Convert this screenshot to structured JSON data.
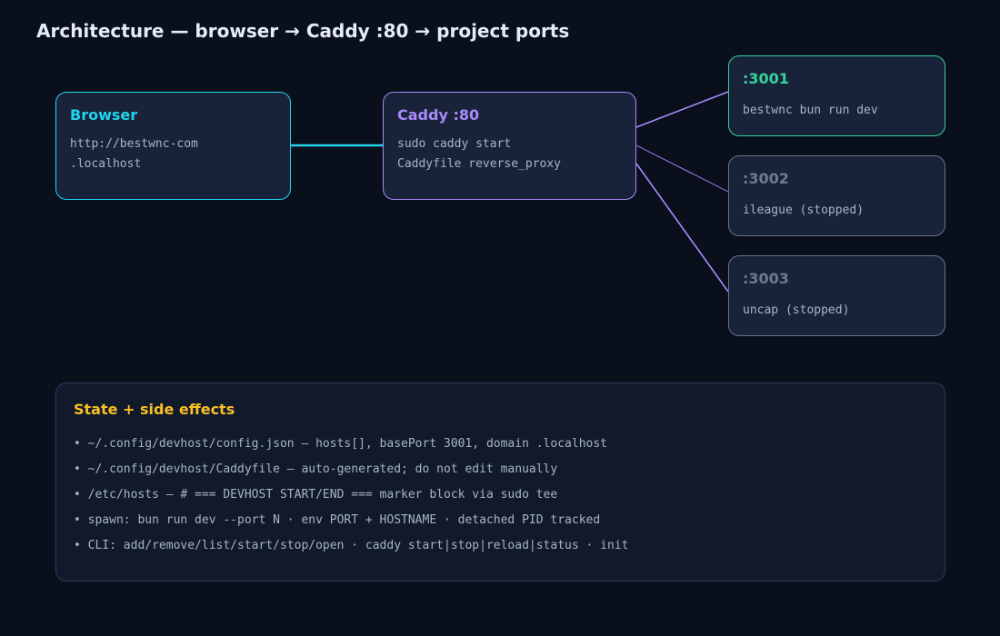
{
  "title": "Architecture — browser → Caddy :80 → project ports",
  "colors": {
    "background": "#0a0f1c",
    "browser_accent": "#22d3ee",
    "caddy_accent": "#a78bfa",
    "active_port": "#34d399",
    "stopped_port": "#64748b",
    "state_accent": "#fbbf24"
  },
  "nodes": {
    "browser": {
      "title": "Browser",
      "lines": [
        "http://bestwnc-com",
        ".localhost"
      ]
    },
    "caddy": {
      "title": "Caddy :80",
      "lines": [
        "sudo caddy start",
        "Caddyfile reverse_proxy"
      ]
    },
    "ports": [
      {
        "title": ":3001",
        "line": "bestwnc bun run dev",
        "status": "running"
      },
      {
        "title": ":3002",
        "line": "ileague (stopped)",
        "status": "stopped"
      },
      {
        "title": ":3003",
        "line": "uncap (stopped)",
        "status": "stopped"
      }
    ]
  },
  "state": {
    "title": "State + side effects",
    "items": [
      "• ~/.config/devhost/config.json — hosts[], basePort 3001, domain .localhost",
      "• ~/.config/devhost/Caddyfile — auto-generated; do not edit manually",
      "• /etc/hosts — # === DEVHOST START/END === marker block via sudo tee",
      "• spawn: bun run dev --port N · env PORT + HOSTNAME · detached PID tracked",
      "• CLI: add/remove/list/start/stop/open · caddy start|stop|reload|status · init"
    ]
  }
}
